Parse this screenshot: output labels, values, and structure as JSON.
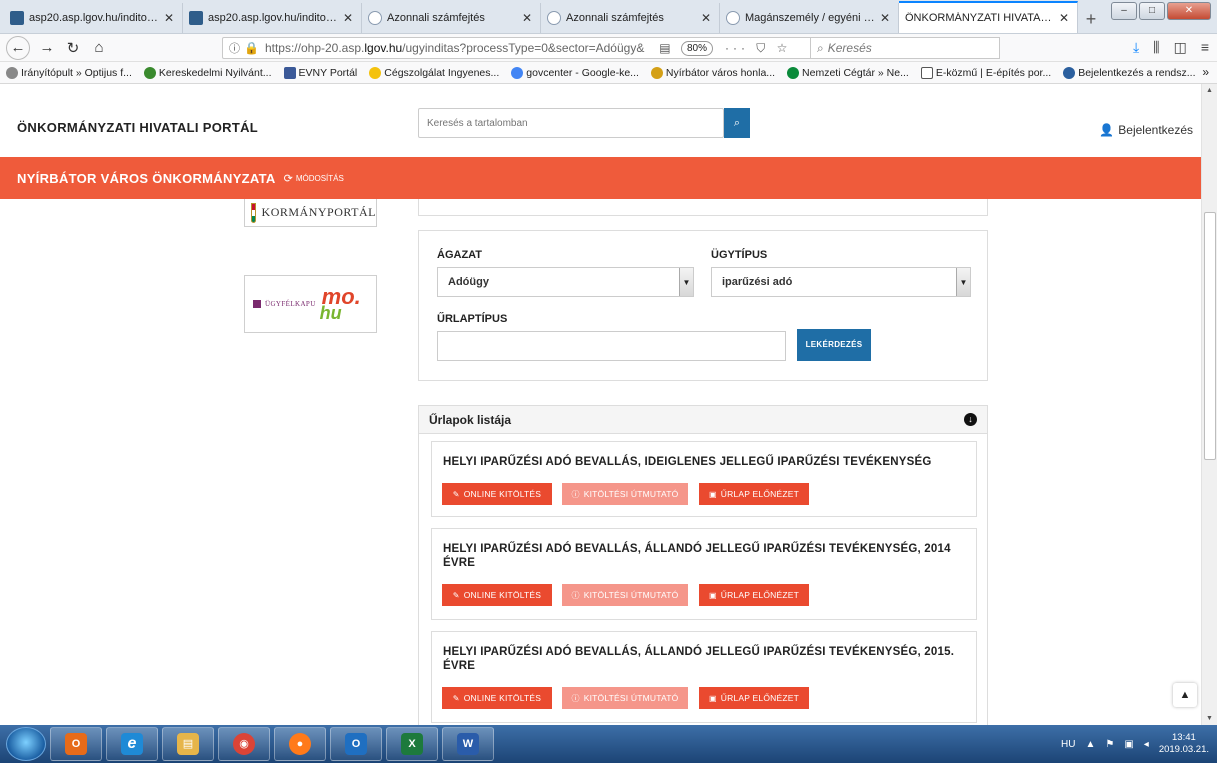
{
  "browser": {
    "tabs": [
      {
        "title": "asp20.asp.lgov.hu/inditopult",
        "icon": "asp-favicon",
        "active": false
      },
      {
        "title": "asp20.asp.lgov.hu/inditopult",
        "icon": "asp-favicon",
        "active": false
      },
      {
        "title": "Azonnali számfejtés",
        "icon": "azonnali-favicon",
        "active": false
      },
      {
        "title": "Azonnali számfejtés",
        "icon": "azonnali-favicon",
        "active": false
      },
      {
        "title": "Magánszemély / egyéni váll",
        "icon": "azonnali-favicon",
        "active": false
      },
      {
        "title": "ÖNKORMÁNYZATI HIVATALI PO",
        "icon": "none",
        "active": true
      }
    ],
    "new_tab": "+",
    "url_prefix": "https://ohp-20.asp.",
    "url_domain": "lgov.hu",
    "url_suffix": "/ugyinditas?processType=0&sector=Adóügy&",
    "zoom": "80%",
    "page_actions": "··· ⛉ ☆",
    "search_placeholder": "Keresés",
    "bookmarks": [
      {
        "label": "Irányítópult » Optijus f...",
        "color": "#888888"
      },
      {
        "label": "Kereskedelmi Nyilvánt...",
        "color": "#3a8a2e"
      },
      {
        "label": "EVNY Portál",
        "color": "#3b5998"
      },
      {
        "label": "Cégszolgálat Ingyenes...",
        "color": "#f4c20d"
      },
      {
        "label": "govcenter - Google-ke...",
        "color": "#4285f4"
      },
      {
        "label": "Nyírbátor város honla...",
        "color": "#d4a017"
      },
      {
        "label": "Nemzeti Cégtár » Ne...",
        "color": "#0a8a3a"
      },
      {
        "label": "E-közmű | E-építés por...",
        "color": "#555555"
      },
      {
        "label": "Bejelentkezés a rendsz...",
        "color": "#2b5f9e"
      }
    ],
    "bookmarks_more": "»"
  },
  "site": {
    "title": "ÖNKORMÁNYZATI HIVATALI PORTÁL",
    "search_placeholder": "Keresés a tartalomban",
    "login": "Bejelentkezés",
    "municipality": "NYÍRBÁTOR VÁROS ÖNKORMÁNYZATA",
    "modify": "MÓDOSÍTÁS",
    "accent_color": "#ef5b3b",
    "primary_color": "#1f6ea6"
  },
  "logos": {
    "kormanyportal": "KORMÁNYPORTÁL",
    "ugyfelkapu": "ÜGYFÉLKAPU",
    "mo": "mo.",
    "hu": "hu"
  },
  "filter": {
    "sector_label": "ÁGAZAT",
    "sector_value": "Adóügy",
    "type_label": "ÜGYTÍPUS",
    "type_value": "iparűzési adó",
    "form_type_label": "ŰRLAPTÍPUS",
    "form_type_value": "",
    "query_button": "LEKÉRDEZÉS"
  },
  "forms": {
    "title": "Űrlapok listája",
    "items": [
      {
        "title": "HELYI IPARŰZÉSI ADÓ BEVALLÁS, IDEIGLENES JELLEGŰ IPARŰZÉSI TEVÉKENYSÉG"
      },
      {
        "title": "HELYI IPARŰZÉSI ADÓ BEVALLÁS, ÁLLANDÓ JELLEGŰ IPARŰZÉSI TEVÉKENYSÉG, 2014 ÉVRE"
      },
      {
        "title": "HELYI IPARŰZÉSI ADÓ BEVALLÁS, ÁLLANDÓ JELLEGŰ IPARŰZÉSI TEVÉKENYSÉG, 2015. ÉVRE"
      }
    ],
    "btn_online": "ONLINE KITÖLTÉS",
    "btn_guide": "KITÖLTÉSI ÚTMUTATÓ",
    "btn_preview": "ŰRLAP ELŐNÉZET"
  },
  "taskbar": {
    "apps": [
      {
        "name": "outlook-app",
        "label": "O",
        "color": "#e66b1a"
      },
      {
        "name": "ie-app",
        "label": "e",
        "color": "#1f8ad6"
      },
      {
        "name": "explorer-app",
        "label": "▤",
        "color": "#e6b54a"
      },
      {
        "name": "chrome-app",
        "label": "◉",
        "color": "#db4437"
      },
      {
        "name": "firefox-app",
        "label": "●",
        "color": "#ff7a1a"
      },
      {
        "name": "outlook2-app",
        "label": "O",
        "color": "#1f6fc1"
      },
      {
        "name": "excel-app",
        "label": "X",
        "color": "#1d7a3c"
      },
      {
        "name": "word-app",
        "label": "W",
        "color": "#2a5caa"
      }
    ],
    "lang": "HU",
    "time": "13:41",
    "date": "2019.03.21."
  }
}
